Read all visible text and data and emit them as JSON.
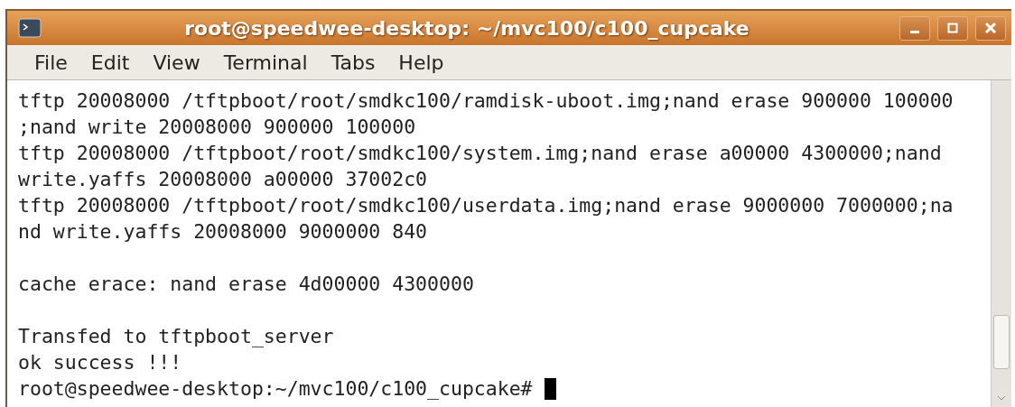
{
  "window": {
    "title": "root@speedwee-desktop: ~/mvc100/c100_cupcake"
  },
  "menu": [
    "File",
    "Edit",
    "View",
    "Terminal",
    "Tabs",
    "Help"
  ],
  "terminal": {
    "blocks": [
      [
        "tftp 20008000 /tftpboot/root/smdkc100/ramdisk-uboot.img;nand erase 900000 100000",
        ";nand write 20008000 900000 100000",
        "tftp 20008000 /tftpboot/root/smdkc100/system.img;nand erase a00000 4300000;nand",
        "write.yaffs 20008000 a00000 37002c0",
        "tftp 20008000 /tftpboot/root/smdkc100/userdata.img;nand erase 9000000 7000000;na",
        "nd write.yaffs 20008000 9000000 840"
      ],
      [
        "cache erace: nand erase 4d00000 4300000"
      ],
      [
        "Transfed to tftpboot_server",
        "ok success !!!"
      ]
    ],
    "prompt": "root@speedwee-desktop:~/mvc100/c100_cupcake#"
  }
}
